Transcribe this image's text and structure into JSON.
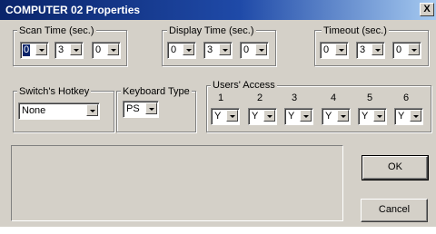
{
  "window": {
    "title": "COMPUTER 02 Properties",
    "close_label": "X"
  },
  "scan_time": {
    "label": "Scan Time (sec.)",
    "values": [
      "0",
      "3",
      "0"
    ]
  },
  "display_time": {
    "label": "Display Time (sec.)",
    "values": [
      "0",
      "3",
      "0"
    ]
  },
  "timeout": {
    "label": "Timeout (sec.)",
    "values": [
      "0",
      "3",
      "0"
    ]
  },
  "switch_hotkey": {
    "label": "Switch's Hotkey",
    "value": "None"
  },
  "keyboard_type": {
    "label": "Keyboard Type",
    "value": "PS"
  },
  "users_access": {
    "label": "Users' Access",
    "columns": [
      "1",
      "2",
      "3",
      "4",
      "5",
      "6"
    ],
    "values": [
      "Y",
      "Y",
      "Y",
      "Y",
      "Y",
      "Y"
    ]
  },
  "buttons": {
    "ok": "OK",
    "cancel": "Cancel"
  },
  "colors": {
    "titlebar_start": "#0a246a",
    "titlebar_end": "#a6caf0",
    "dialog_bg": "#d4d0c8",
    "selection": "#0a246a"
  }
}
